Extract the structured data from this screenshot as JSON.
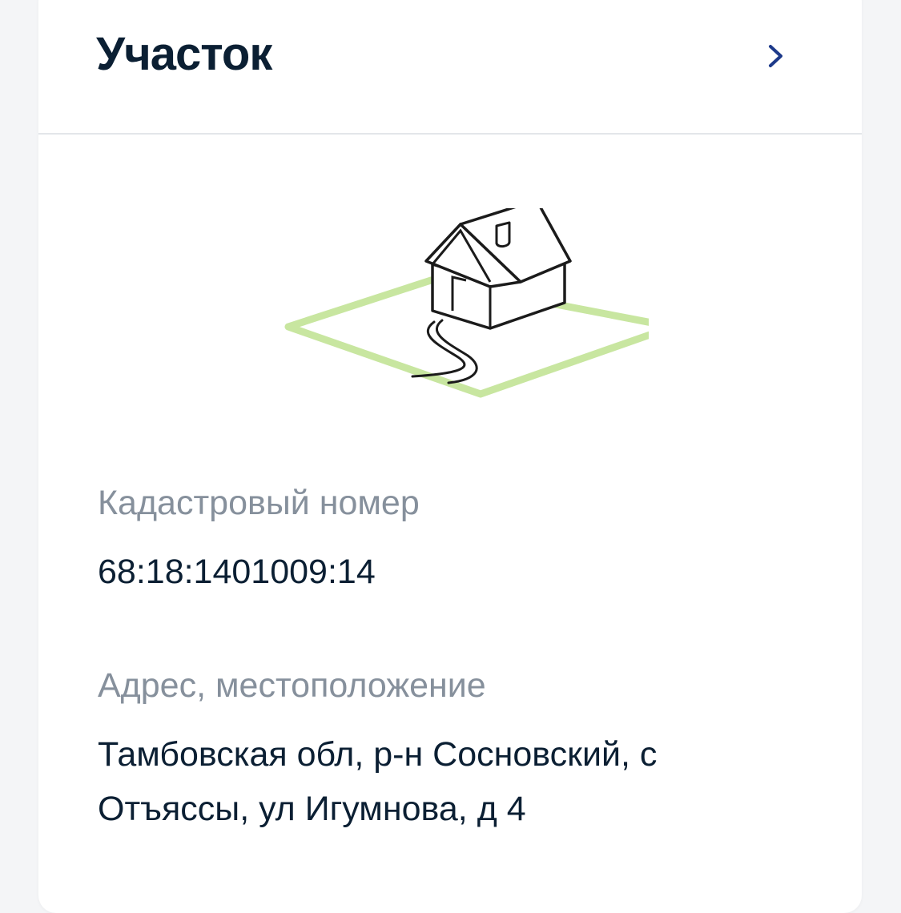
{
  "section": {
    "title": "Участок",
    "open_icon": "chevron-right-icon"
  },
  "illustration": {
    "icon": "house-on-plot-icon",
    "plot_color": "#c8e6a0"
  },
  "cadastral": {
    "label": "Кадастровый номер",
    "value": "68:18:1401009:14"
  },
  "address": {
    "label": "Адрес, местоположение",
    "line1": "Тамбовская обл, р-н Сосновский, с",
    "line2": "Отъяссы, ул Игумнова, д 4"
  },
  "colors": {
    "title": "#0b1f33",
    "label": "#86909c",
    "accent": "#1d3a8a"
  }
}
